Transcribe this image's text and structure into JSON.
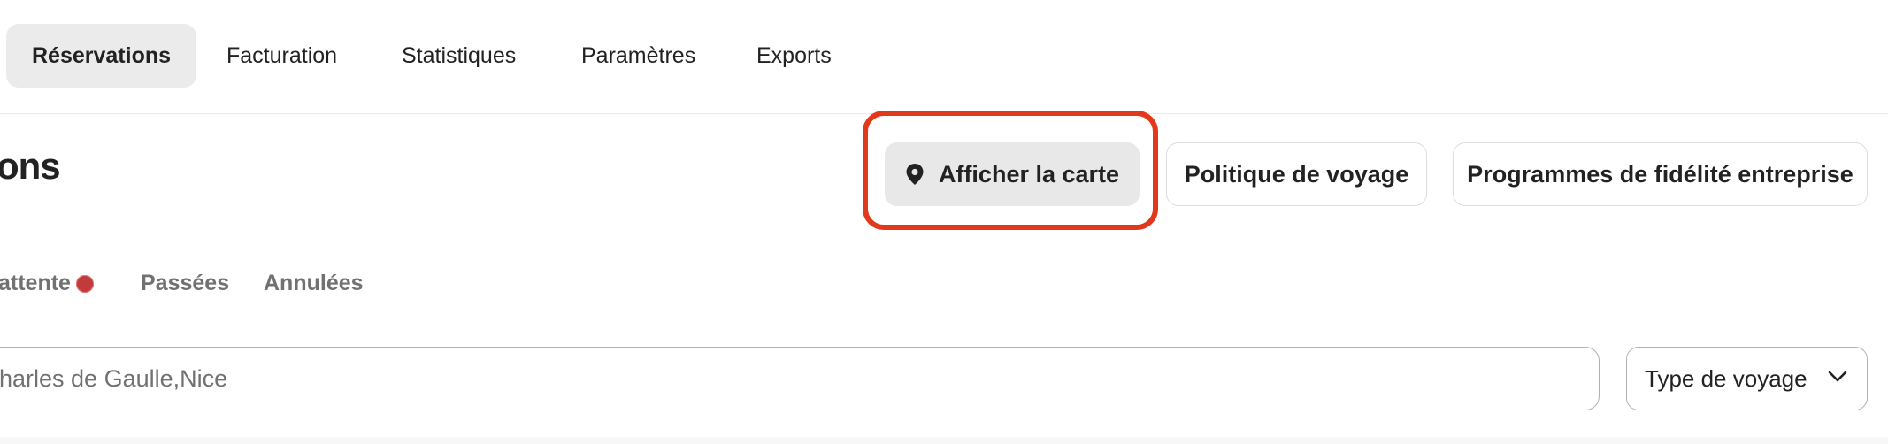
{
  "nav": {
    "tabs": [
      {
        "label": "Réservations",
        "active": true
      },
      {
        "label": "Facturation"
      },
      {
        "label": "Statistiques"
      },
      {
        "label": "Paramètres"
      },
      {
        "label": "Exports"
      }
    ]
  },
  "page": {
    "title": "ons"
  },
  "actions": {
    "map_label": "Afficher la carte",
    "map_icon": "map-pin-icon",
    "policy_label": "Politique de voyage",
    "loyalty_label": "Programmes de fidélité entreprise"
  },
  "subtabs": {
    "pending_label": "attente",
    "past_label": "Passées",
    "cancelled_label": "Annulées"
  },
  "search": {
    "placeholder": "harles de Gaulle,Nice"
  },
  "filter": {
    "trip_type_label": "Type de voyage"
  },
  "colors": {
    "highlight": "#e0391c",
    "badge": "#c13b3b",
    "active_tab_bg": "#ebebeb"
  }
}
